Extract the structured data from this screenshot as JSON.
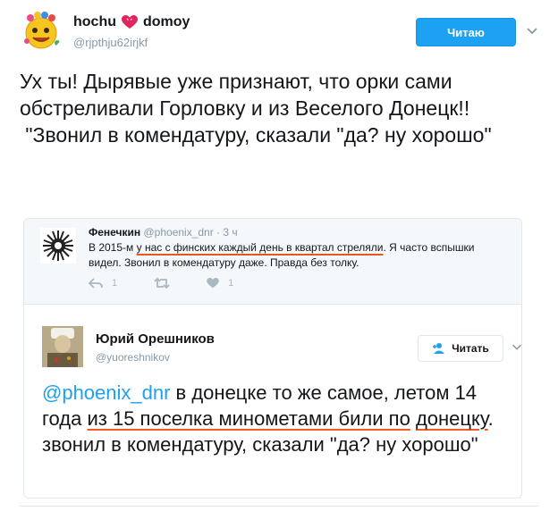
{
  "tweet": {
    "name": "hochu",
    "name_suffix": "domoy",
    "handle": "@rjpthju62irjkf",
    "follow_label": "Читаю",
    "text": "Ух ты! Дырявые уже признают, что орки сами обстреливали Горловку и из Веселого Донецк!!\n \"Звонил в комендатуру, сказали \"да? ну хорошо\""
  },
  "quoted": {
    "name": "Фенечкин",
    "handle": "@phoenix_dnr",
    "time": "· 3 ч",
    "text_pre": "В 2015-м ",
    "text_underlined": "у нас с финских каждый день в квартал стреляли",
    "text_post": ". Я часто вспышки видел. Звонил в комендатуру даже. Правда без толку.",
    "reply_count": "1",
    "like_count": "1"
  },
  "reply": {
    "name": "Юрий Орешников",
    "handle": "@yuoreshnikov",
    "follow_label": "Читать",
    "mention": "@phoenix_dnr",
    "text_a": " в донецке то же самое, летом 14 года ",
    "text_underlined1": "из 15 поселка минометами били по",
    "text_b": " ",
    "text_underlined2": "донецку",
    "text_c": ". звонил в комендатуру, сказали \"да? ну хорошо\""
  },
  "colors": {
    "accent": "#1da1f2",
    "underline": "#f05a24"
  }
}
